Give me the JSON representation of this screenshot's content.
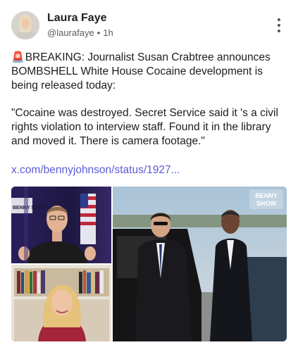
{
  "post": {
    "author_name": "Laura Faye",
    "handle": "@laurafaye",
    "separator": "•",
    "time": "1h",
    "siren": "🚨",
    "headline": "BREAKING: Journalist Susan Crabtree announces BOMBSHELL White House Cocaine development is being released today:",
    "quote": "\"Cocaine was destroyed. Secret Service said it 's a civil rights violation to interview staff. Found it in the library and moved it. There is camera footage.\"",
    "link": "x.com/bennyjohnson/status/1927..."
  },
  "media": {
    "watermark_left": "BENNY SHOW",
    "watermark_right_line1": "BENNY",
    "watermark_right_line2": "SHOW"
  },
  "colors": {
    "link": "#5b5bd6",
    "menu_dots": "#555555",
    "siren": "#d62626"
  },
  "icons": {
    "menu": "more-vertical-icon",
    "siren": "siren-icon"
  }
}
